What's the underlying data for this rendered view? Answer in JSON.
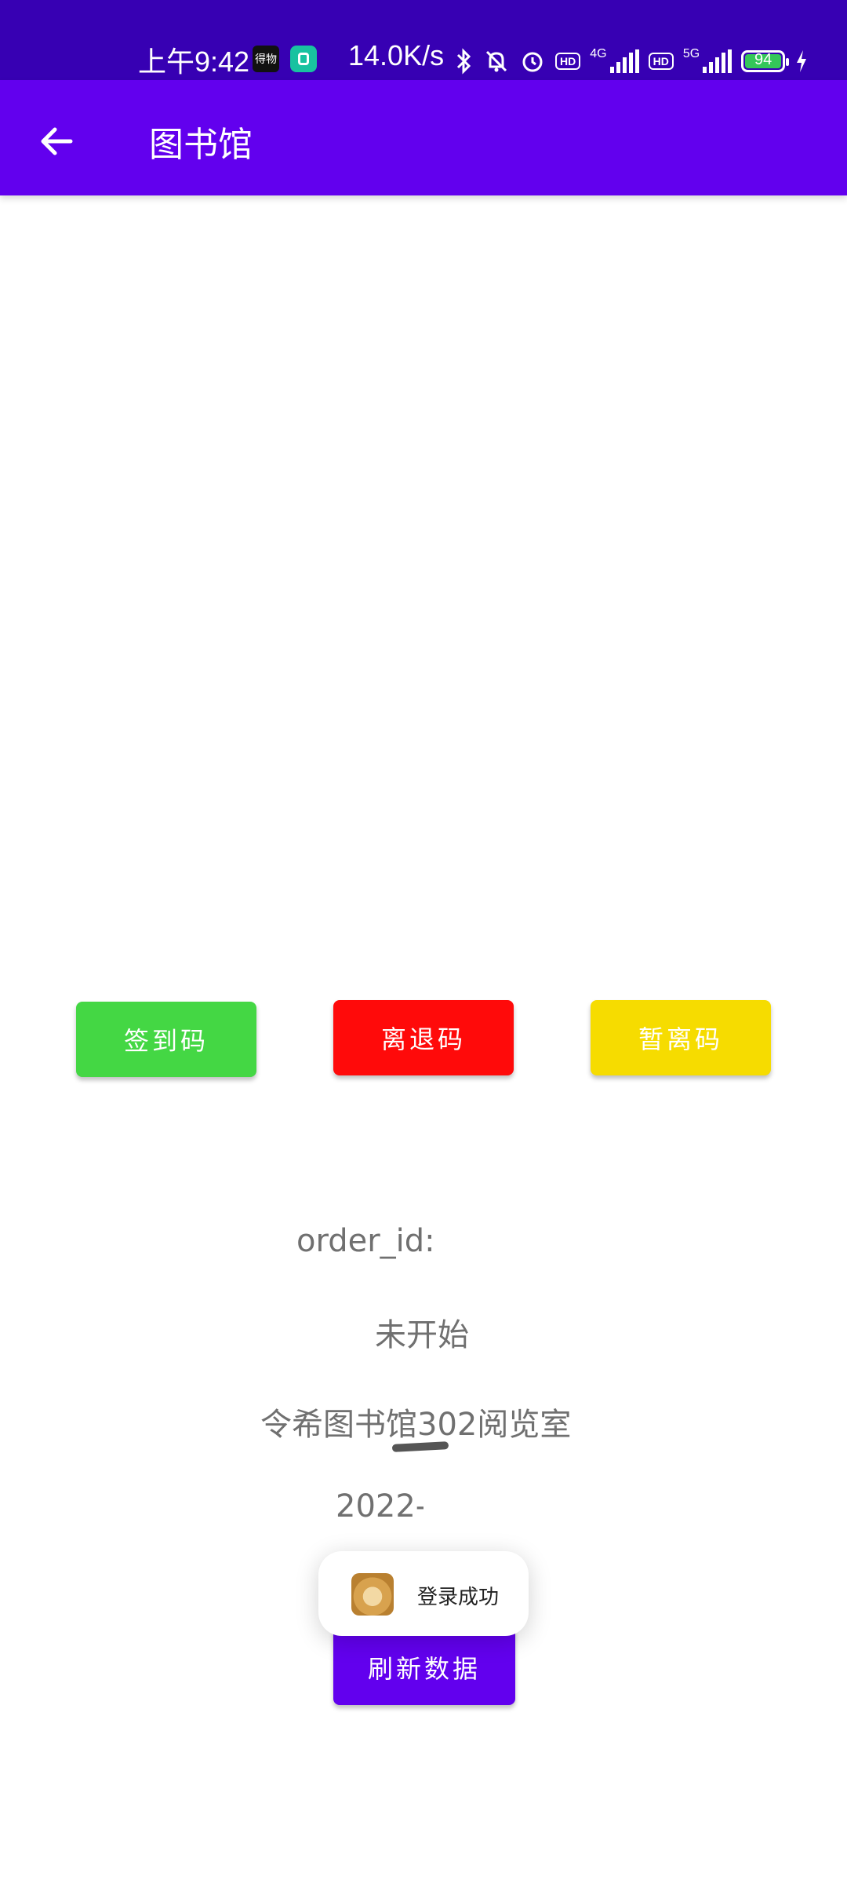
{
  "status_bar": {
    "time": "上午9:42",
    "app_icon_1": "得物",
    "net_speed": "14.0K/s",
    "network_1": "4G",
    "network_2": "5G",
    "hd_label": "HD",
    "battery_level": "94",
    "icons": [
      "bluetooth-icon",
      "mute-bell-icon",
      "alarm-icon",
      "signal-icon",
      "battery-icon",
      "charging-icon"
    ]
  },
  "app_bar": {
    "title": "图书馆",
    "back_icon": "arrow-left-icon"
  },
  "actions": {
    "sign_in": "签到码",
    "leave": "离退码",
    "pause": "暂离码"
  },
  "info": {
    "order_id": "order_id:",
    "status": "未开始",
    "room": "令希图书馆302阅览室",
    "date": "2022-"
  },
  "toast": {
    "message": "登录成功",
    "avatar": "doge-avatar"
  },
  "refresh_label": "刷新数据",
  "colors": {
    "status_bar": "#3700B3",
    "app_bar": "#6200EE",
    "sign_in": "#44D744",
    "leave": "#FF0A0A",
    "pause": "#F6DC00",
    "refresh": "#6200EE"
  }
}
